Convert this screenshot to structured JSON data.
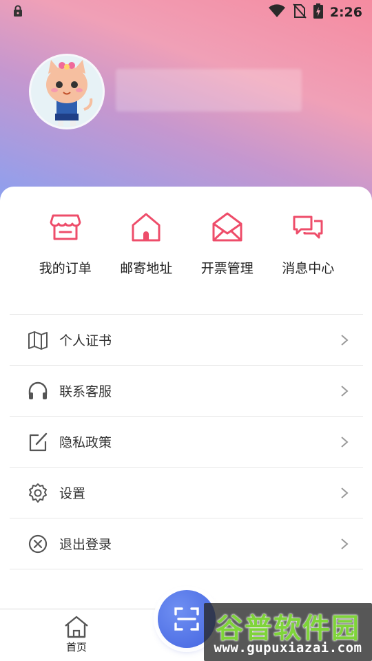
{
  "status_bar": {
    "time": "2:26",
    "icons": [
      "lock-icon",
      "wifi-icon",
      "no-sim-icon",
      "battery-charging-icon"
    ]
  },
  "profile": {
    "avatar_icon": "cartoon-cat-avatar",
    "name": ""
  },
  "quick_actions": [
    {
      "label": "我的订单",
      "icon": "store-icon"
    },
    {
      "label": "邮寄地址",
      "icon": "home-icon"
    },
    {
      "label": "开票管理",
      "icon": "envelope-icon"
    },
    {
      "label": "消息中心",
      "icon": "chat-bubbles-icon"
    }
  ],
  "menu": [
    {
      "label": "个人证书",
      "icon": "map-icon"
    },
    {
      "label": "联系客服",
      "icon": "headphones-icon"
    },
    {
      "label": "隐私政策",
      "icon": "edit-icon"
    },
    {
      "label": "设置",
      "icon": "gear-icon"
    },
    {
      "label": "退出登录",
      "icon": "close-circle-icon"
    }
  ],
  "tab_bar": {
    "home_label": "首页",
    "center_icon": "scan-icon"
  },
  "watermark": {
    "title": "谷普软件园",
    "url": "www.gupuxiazai.com"
  },
  "colors": {
    "accent_pink": "#ee4d6a",
    "scan_blue": "#4a6ae4",
    "gradient_top": "#f58ba0",
    "gradient_bottom": "#8aa0f0"
  }
}
